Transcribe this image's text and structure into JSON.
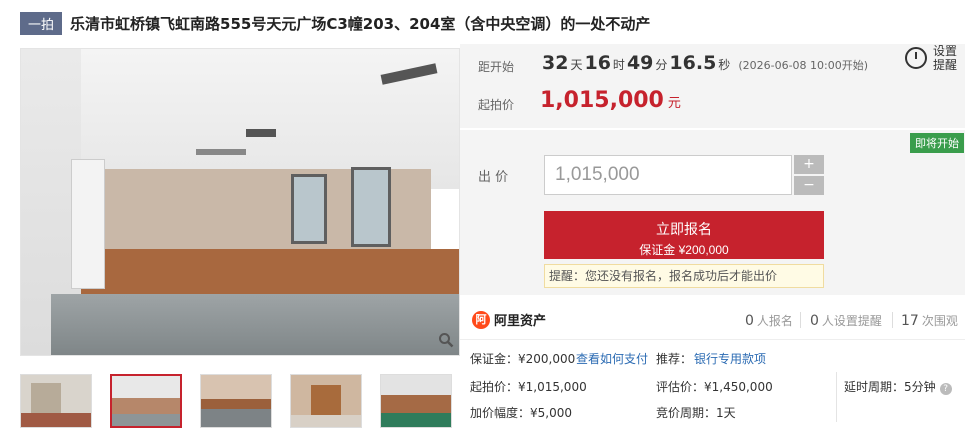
{
  "header": {
    "badge": "一拍",
    "title": "乐清市虹桥镇飞虹南路555号天元广场C3幢203、204室（含中央空调）的一处不动产"
  },
  "countdown": {
    "label": "距开始",
    "days": "32",
    "days_unit": "天",
    "hours": "16",
    "hours_unit": "时",
    "minutes": "49",
    "minutes_unit": "分",
    "seconds": "16.5",
    "seconds_unit": "秒",
    "start_time": "(2026-06-08 10:00开始)"
  },
  "starting_price": {
    "label": "起拍价",
    "value": "1,015,000",
    "unit": "元"
  },
  "reminder": {
    "label": "设置提醒"
  },
  "status_tag": "即将开始",
  "bid": {
    "label": "出 价",
    "value": "1,015,000",
    "plus": "+",
    "minus": "−",
    "signup_label": "立即报名",
    "signup_deposit": "保证金 ¥200,000",
    "notice": "提醒：您还没有报名，报名成功后才能出价"
  },
  "stats": {
    "brand": "阿里资产",
    "brand_icon": "阿",
    "registrations_count": "0",
    "registrations_label": "人报名",
    "reminders_count": "0",
    "reminders_label": "人设置提醒",
    "views_count": "17",
    "views_label": "次围观"
  },
  "details": {
    "deposit": "保证金：¥200,000",
    "how_to_pay": "查看如何支付",
    "recommend_label": "推荐：",
    "recommend_link": "银行专用款项",
    "start_price": "起拍价：¥1,015,000",
    "appraisal": "评估价：¥1,450,000",
    "delay_period": "延时周期：5分钟",
    "increment": "加价幅度：¥5,000",
    "bid_period": "竞价周期：1天"
  },
  "icons": {
    "zoom": "magnifier-icon",
    "reminder": "alarm-clock-icon",
    "help": "question-icon"
  },
  "colors": {
    "accent": "#c6222d",
    "tag": "#3a9d4c",
    "link": "#2b6bb3"
  }
}
